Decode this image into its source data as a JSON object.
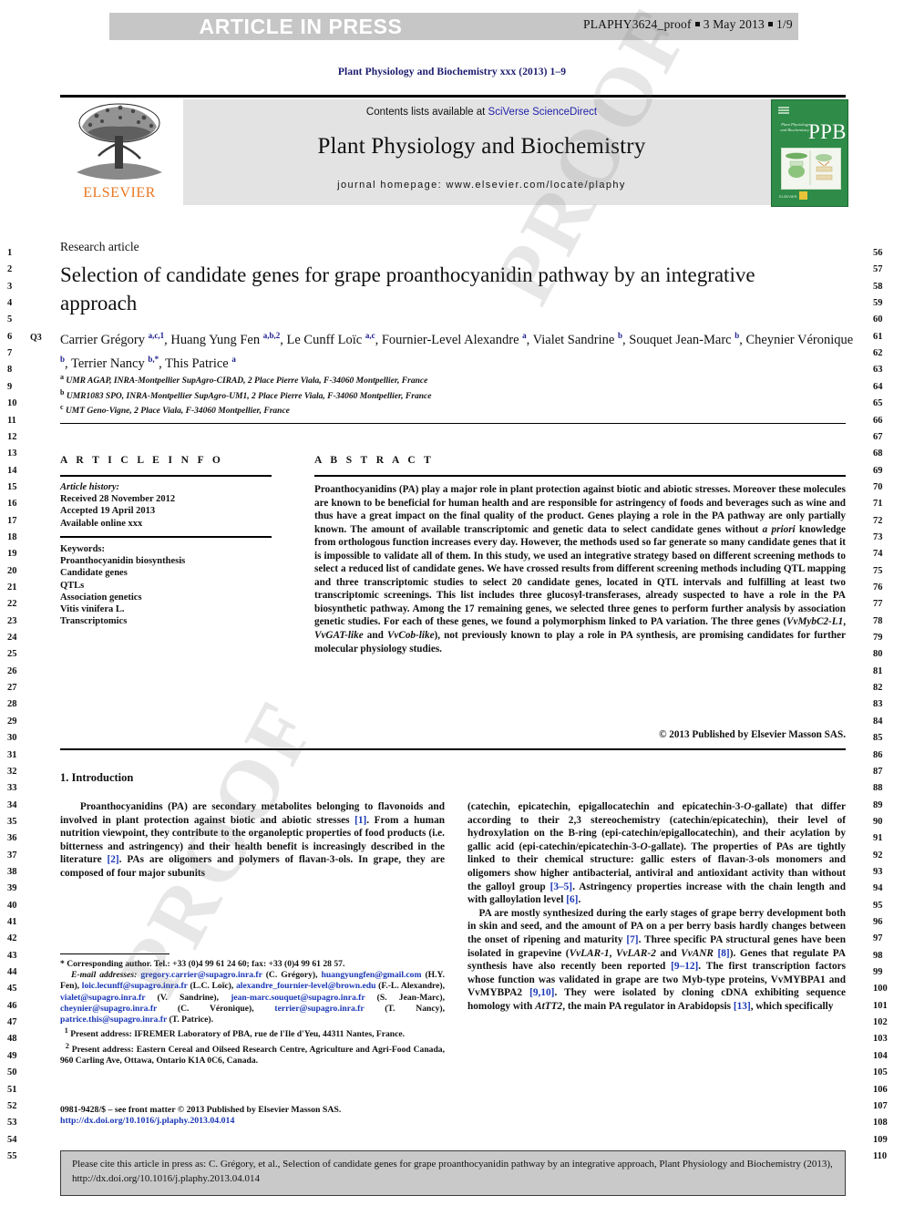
{
  "press_header": {
    "banner_label": "ARTICLE IN PRESS",
    "proof_id": "PLAPHY3624_proof",
    "proof_date": "3 May 2013",
    "proof_page": "1/9",
    "banner_bg": "#c6c6c6",
    "banner_text_color": "#ffffff"
  },
  "journal_ref": "Plant Physiology and Biochemistry xxx (2013) 1–9",
  "masthead": {
    "contents_prefix": "Contents lists available at ",
    "contents_link": "SciVerse ScienceDirect",
    "journal_name": "Plant Physiology and Biochemistry",
    "homepage": "journal homepage: www.elsevier.com/locate/plaphy",
    "publisher_logo_text": "ELSEVIER",
    "publisher_logo_color": "#e87722",
    "cover_abbr": "PPB",
    "cover_journal_lines": "Plant Physiology and Biochemistry",
    "cover_bg": "#2e8b48",
    "link_color": "#2222aa"
  },
  "article": {
    "kicker": "Research article",
    "title": "Selection of candidate genes for grape proanthocyanidin pathway by an integrative approach",
    "query_tag": "Q3",
    "authors_html": "Carrier Grégory <sup>a,c,1</sup>, Huang Yung Fen <sup>a,b,2</sup>, Le Cunff Loïc <sup>a,c</sup>, Fournier-Level Alexandre <sup>a</sup>, Vialet Sandrine <sup>b</sup>, Souquet Jean-Marc <sup>b</sup>, Cheynier Véronique <sup>b</sup>, Terrier Nancy <sup>b,*</sup>, This Patrice <sup>a</sup>",
    "affiliations": [
      {
        "marker": "a",
        "text": "UMR AGAP, INRA-Montpellier SupAgro-CIRAD, 2 Place Pierre Viala, F-34060 Montpellier, France"
      },
      {
        "marker": "b",
        "text": "UMR1083 SPO, INRA-Montpellier SupAgro-UM1, 2 Place Pierre Viala, F-34060 Montpellier, France"
      },
      {
        "marker": "c",
        "text": "UMT Geno-Vigne, 2 Place Viala, F-34060 Montpellier, France"
      }
    ]
  },
  "article_info": {
    "heading": "A R T I C L E  I N F O",
    "history_label": "Article history:",
    "history": [
      "Received 28 November 2012",
      "Accepted 19 April 2013",
      "Available online xxx"
    ],
    "keywords_label": "Keywords:",
    "keywords": [
      "Proanthocyanidin biosynthesis",
      "Candidate genes",
      "QTLs",
      "Association genetics",
      "Vitis vinifera L.",
      "Transcriptomics"
    ]
  },
  "abstract": {
    "heading": "A B S T R A C T",
    "body_html": "Proanthocyanidins (PA) play a major role in plant protection against biotic and abiotic stresses. Moreover these molecules are known to be beneficial for human health and are responsible for astringency of foods and beverages such as wine and thus have a great impact on the final quality of the product. Genes playing a role in the PA pathway are only partially known. The amount of available transcriptomic and genetic data to select candidate genes without <span class=\"it\">a priori</span> knowledge from orthologous function increases every day. However, the methods used so far generate so many candidate genes that it is impossible to validate all of them. In this study, we used an integrative strategy based on different screening methods to select a reduced list of candidate genes. We have crossed results from different screening methods including QTL mapping and three transcriptomic studies to select 20 candidate genes, located in QTL intervals and fulfilling at least two transcriptomic screenings. This list includes three glucosyl-transferases, already suspected to have a role in the PA biosynthetic pathway. Among the 17 remaining genes, we selected three genes to perform further analysis by association genetic studies. For each of these genes, we found a polymorphism linked to PA variation. The three genes (<span class=\"it\">VvMybC2-L1</span>, <span class=\"it\">VvGAT-like</span> and <span class=\"it\">VvCob-like</span>), not previously known to play a role in PA synthesis, are promising candidates for further molecular physiology studies.",
    "copyright": "© 2013 Published by Elsevier Masson SAS."
  },
  "body": {
    "section_number_title": "1. Introduction",
    "left_column_html": "&nbsp;&nbsp;&nbsp;&nbsp;Proanthocyanidins (PA) are secondary metabolites belonging to flavonoids and involved in plant protection against biotic and abiotic stresses <span class=\"ref\">[1]</span>. From a human nutrition viewpoint, they contribute to the organoleptic properties of food products (i.e. bitterness and astringency) and their health benefit is increasingly described in the literature <span class=\"ref\">[2]</span>. PAs are oligomers and polymers of flavan-3-ols. In grape, they are composed of four major subunits",
    "right_column_html": "(catechin, epicatechin, epigallocatechin and epicatechin-3-<span class=\"it\">O</span>-gallate) that differ according to their 2,3 stereochemistry (catechin/epicatechin), their level of hydroxylation on the B-ring (epi-catechin/epigallocatechin), and their acylation by gallic acid (epi-catechin/epicatechin-3-<span class=\"it\">O</span>-gallate). The properties of PAs are tightly linked to their chemical structure: gallic esters of flavan-3-ols monomers and oligomers show higher antibacterial, antiviral and antioxidant activity than without the galloyl group <span class=\"ref\">[3–5]</span>. Astringency properties increase with the chain length and with galloylation level <span class=\"ref\">[6]</span>.<br>&nbsp;&nbsp;&nbsp;&nbsp;PA are mostly synthesized during the early stages of grape berry development both in skin and seed, and the amount of PA on a per berry basis hardly changes between the onset of ripening and maturity <span class=\"ref\">[7]</span>. Three specific PA structural genes have been isolated in grapevine (<span class=\"it\">VvLAR-1</span>, <span class=\"it\">VvLAR-2</span> and <span class=\"it\">VvANR</span> <span class=\"ref\">[8]</span>). Genes that regulate PA synthesis have also recently been reported <span class=\"ref\">[9–12]</span>. The first transcription factors whose function was validated in grape are two Myb-type proteins, VvMYBPA1 and VvMYBPA2 <span class=\"ref\">[9,10]</span>. They were isolated by cloning cDNA exhibiting sequence homology with <span class=\"it\">AtTT2</span>, the main PA regulator in Arabidopsis <span class=\"ref\">[13]</span>, which specifically"
  },
  "footnotes": {
    "body_html": "* Corresponding author. Tel.: +33 (0)4 99 61 24 60; fax: +33 (0)4 99 61 28 57.<br><span class=\"it\">&nbsp;&nbsp;&nbsp;E-mail addresses:</span> <span class=\"mail\">gregory.carrier@supagro.inra.fr</span> (C. Grégory), <span class=\"mail\">huangyungfen@gmail.com</span> (H.Y. Fen), <span class=\"mail\">loic.lecunff@supagro.inra.fr</span> (L.C. Loïc), <span class=\"mail\">alexandre_fournier-level@brown.edu</span> (F.-L. Alexandre), <span class=\"mail\">vialet@supagro.inra.fr</span> (V. Sandrine), <span class=\"mail\">jean-marc.souquet@supagro.inra.fr</span> (S. Jean-Marc), <span class=\"mail\">cheynier@supagro.inra.fr</span> (C. Véronique), <span class=\"mail\">terrier@supagro.inra.fr</span> (T. Nancy), <span class=\"mail\">patrice.this@supagro.inra.fr</span> (T. Patrice).<br>&nbsp;&nbsp;<sup>1</sup> Present address: IFREMER Laboratory of PBA, rue de l'Ile d'Yeu, 44311 Nantes, France.<br>&nbsp;&nbsp;<sup>2</sup> Present address: Eastern Cereal and Oilseed Research Centre, Agriculture and Agri-Food Canada, 960 Carling Ave, Ottawa, Ontario K1A 0C6, Canada.",
    "front_matter": "0981-9428/$ – see front matter © 2013 Published by Elsevier Masson SAS.",
    "doi": "http://dx.doi.org/10.1016/j.plaphy.2013.04.014"
  },
  "citation_footer": {
    "text": "Please cite this article in press as: C. Grégory, et al., Selection of candidate genes for grape proanthocyanidin pathway by an integrative approach, Plant Physiology and Biochemistry (2013), http://dx.doi.org/10.1016/j.plaphy.2013.04.014"
  },
  "line_numbers": {
    "left_start": 1,
    "left_end": 55,
    "right_start": 56,
    "right_end": 110
  },
  "watermark": "PROOF"
}
